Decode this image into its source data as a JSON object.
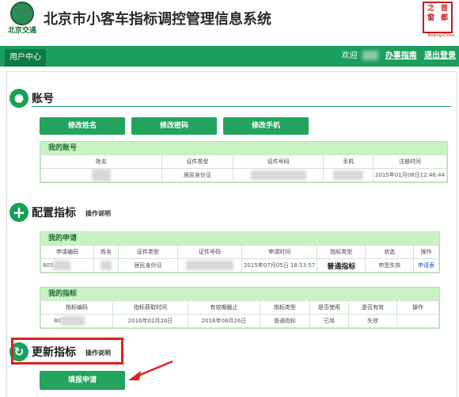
{
  "header": {
    "logo_text": "北京交通",
    "title": "北京市小客车指标调控管理信息系统",
    "stamp_text": [
      "首",
      "之",
      "都",
      "窗"
    ],
    "stamp_sub": "Beijing-China"
  },
  "nav": {
    "tab_label": "用户中心",
    "welcome": "欢迎",
    "guide_link": "办事指南",
    "logout_link": "退出登录"
  },
  "account": {
    "title": "账号",
    "buttons": [
      "修改姓名",
      "修改密码",
      "修改手机"
    ],
    "panel_title": "我的账号",
    "headers": [
      "姓名",
      "证件类型",
      "证件号码",
      "手机",
      "注册时间"
    ],
    "row": [
      "",
      "居民身份证",
      "",
      "",
      "2015年01月08日12:46:44"
    ]
  },
  "config": {
    "title": "配置指标",
    "note": "操作说明",
    "app_panel_title": "我的申请",
    "app_headers": [
      "申请编码",
      "姓名",
      "证件类型",
      "证件号码",
      "申请时间",
      "指标类型",
      "状态",
      "操作"
    ],
    "app_row": [
      "805",
      "",
      "居民身份证",
      "",
      "2015年07月05日 18:53:57",
      "普通指标",
      "申签失效",
      "申请表"
    ],
    "quota_panel_title": "我的指标",
    "quota_headers": [
      "指标编码",
      "指标获取时间",
      "有效期截止",
      "指标类型",
      "是否使用",
      "是否有效",
      "操作"
    ],
    "quota_row": [
      "80",
      "2016年02月26日",
      "2016年08月26日",
      "普通指标",
      "已用",
      "失效",
      ""
    ]
  },
  "renew": {
    "title": "更新指标",
    "note": "操作说明",
    "button": "填报申请"
  },
  "colors": {
    "accent": "#18a058",
    "nav_bg": "#1b9e5e",
    "panel_head": "#c9f2c3",
    "highlight": "#e02020"
  }
}
